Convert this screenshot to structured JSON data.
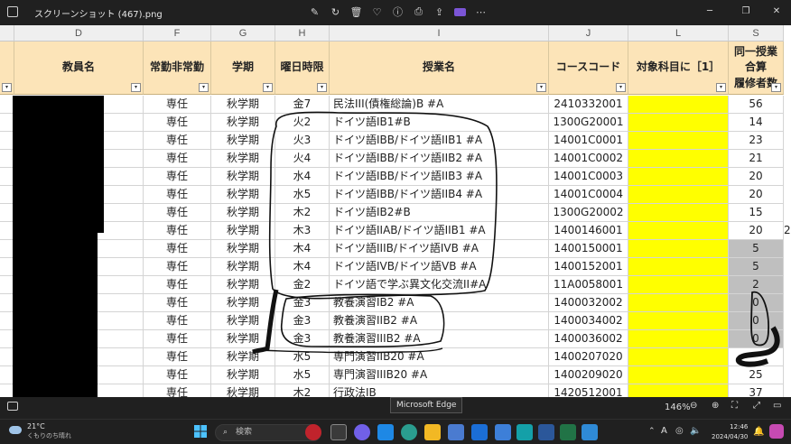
{
  "window": {
    "title": "スクリーンショット (467).png",
    "tools": [
      "edit-icon",
      "rotate-icon",
      "delete-icon",
      "favorite-icon",
      "info-icon",
      "print-icon",
      "share-icon",
      "onedrive-icon",
      "more-icon"
    ],
    "controls": [
      "minimize",
      "restore",
      "close"
    ]
  },
  "sheet": {
    "column_letters": [
      "D",
      "F",
      "G",
      "H",
      "I",
      "J",
      "L",
      "S"
    ],
    "headers": [
      "教員名",
      "常勤非常勤",
      "学期",
      "曜日時限",
      "授業名",
      "コースコード",
      "対象科目に［1］",
      "同一授業\n合算\n履修者数"
    ],
    "rows": [
      {
        "type": "専任",
        "term": "秋学期",
        "slot": "金7",
        "course": "民法III(債権総論)B #A",
        "code": "2410332001",
        "count": "56",
        "gray": false
      },
      {
        "type": "専任",
        "term": "秋学期",
        "slot": "火2",
        "course": "ドイツ語IB1#B",
        "code": "1300G20001",
        "count": "14",
        "gray": false
      },
      {
        "type": "専任",
        "term": "秋学期",
        "slot": "火3",
        "course": "ドイツ語IBB/ドイツ語IIB1 #A",
        "code": "14001C0001",
        "count": "23",
        "gray": false
      },
      {
        "type": "専任",
        "term": "秋学期",
        "slot": "火4",
        "course": "ドイツ語IBB/ドイツ語IIB2 #A",
        "code": "14001C0002",
        "count": "21",
        "gray": false
      },
      {
        "type": "専任",
        "term": "秋学期",
        "slot": "水4",
        "course": "ドイツ語IBB/ドイツ語IIB3 #A",
        "code": "14001C0003",
        "count": "20",
        "gray": false
      },
      {
        "type": "専任",
        "term": "秋学期",
        "slot": "水5",
        "course": "ドイツ語IBB/ドイツ語IIB4 #A",
        "code": "14001C0004",
        "count": "20",
        "gray": false
      },
      {
        "type": "専任",
        "term": "秋学期",
        "slot": "木2",
        "course": "ドイツ語IB2#B",
        "code": "1300G20002",
        "count": "15",
        "gray": false
      },
      {
        "type": "専任",
        "term": "秋学期",
        "slot": "木3",
        "course": "ドイツ語IIAB/ドイツ語IIB1 #A",
        "code": "1400146001",
        "count": "20",
        "gray": false
      },
      {
        "type": "専任",
        "term": "秋学期",
        "slot": "木4",
        "course": "ドイツ語IIIB/ドイツ語IVB #A",
        "code": "1400150001",
        "count": "5",
        "gray": true
      },
      {
        "type": "専任",
        "term": "秋学期",
        "slot": "木4",
        "course": "ドイツ語IVB/ドイツ語VB #A",
        "code": "1400152001",
        "count": "5",
        "gray": true
      },
      {
        "type": "専任",
        "term": "秋学期",
        "slot": "金2",
        "course": "ドイツ語で学ぶ異文化交流II#A",
        "code": "11A0058001",
        "count": "2",
        "gray": true
      },
      {
        "type": "専任",
        "term": "秋学期",
        "slot": "金3",
        "course": "教養演習IB2 #A",
        "code": "1400032002",
        "count": "0",
        "gray": true
      },
      {
        "type": "専任",
        "term": "秋学期",
        "slot": "金3",
        "course": "教養演習IIB2 #A",
        "code": "1400034002",
        "count": "0",
        "gray": true
      },
      {
        "type": "専任",
        "term": "秋学期",
        "slot": "金3",
        "course": "教養演習IIIB2 #A",
        "code": "1400036002",
        "count": "0",
        "gray": true
      },
      {
        "type": "専任",
        "term": "秋学期",
        "slot": "水5",
        "course": "専門演習IIB20 #A",
        "code": "1400207020",
        "count": "",
        "gray": false
      },
      {
        "type": "専任",
        "term": "秋学期",
        "slot": "水5",
        "course": "専門演習IIIB20 #A",
        "code": "1400209020",
        "count": "25",
        "gray": false
      },
      {
        "type": "専任",
        "term": "秋学期",
        "slot": "木2",
        "course": "行政法IB",
        "code": "1420512001",
        "count": "37",
        "gray": false
      }
    ],
    "overflow_mark": "2"
  },
  "viewer": {
    "tooltip": "Microsoft Edge",
    "zoom": "146%"
  },
  "taskbar": {
    "weather_temp": "21°C",
    "weather_text": "くもりのち晴れ",
    "search_placeholder": "検索",
    "time": "12:46",
    "date": "2024/04/30",
    "ime": "A"
  },
  "colors": {
    "header_fill": "#fce4b8",
    "yellow_column": "#ffff00",
    "gray_count": "#bfbfbf"
  }
}
